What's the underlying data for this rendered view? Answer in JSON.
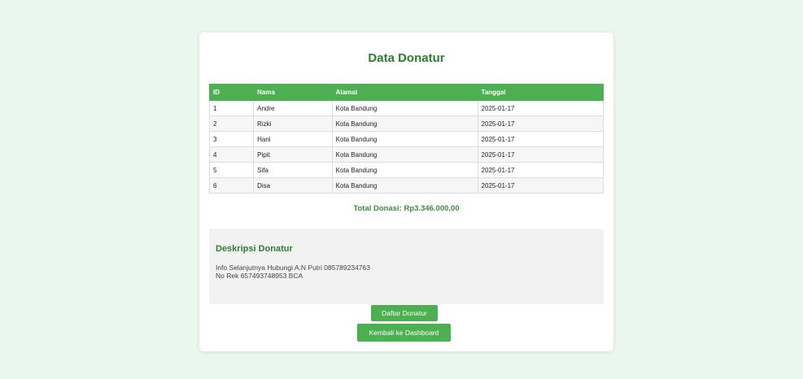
{
  "page": {
    "title": "Data Donatur"
  },
  "table": {
    "headers": {
      "id": "ID",
      "nama": "Nama",
      "alamat": "Alamat",
      "tanggal": "Tanggal"
    },
    "rows": [
      {
        "id": "1",
        "nama": "Andre",
        "alamat": "Kota Bandung",
        "tanggal": "2025-01-17"
      },
      {
        "id": "2",
        "nama": "Rizki",
        "alamat": "Kota Bandung",
        "tanggal": "2025-01-17"
      },
      {
        "id": "3",
        "nama": "Hani",
        "alamat": "Kota Bandung",
        "tanggal": "2025-01-17"
      },
      {
        "id": "4",
        "nama": "Pipit",
        "alamat": "Kota Bandung",
        "tanggal": "2025-01-17"
      },
      {
        "id": "5",
        "nama": "Sifa",
        "alamat": "Kota Bandung",
        "tanggal": "2025-01-17"
      },
      {
        "id": "6",
        "nama": "Disa",
        "alamat": "Kota Bandung",
        "tanggal": "2025-01-17"
      }
    ]
  },
  "total": {
    "text": "Total Donasi: Rp3.346.000,00"
  },
  "description": {
    "title": "Deskripsi Donatur",
    "line1": "Info Selanjutnya Hubungi A.N Putri 085789234763",
    "line2": "No Rek 657493748953 BCA"
  },
  "buttons": {
    "daftar_label": "Daftar Donatur",
    "kembali_label": "Kembali ke Dashboard"
  },
  "colors": {
    "accent": "#4caf50",
    "title": "#2e7d32",
    "background": "#eaf7ee"
  }
}
